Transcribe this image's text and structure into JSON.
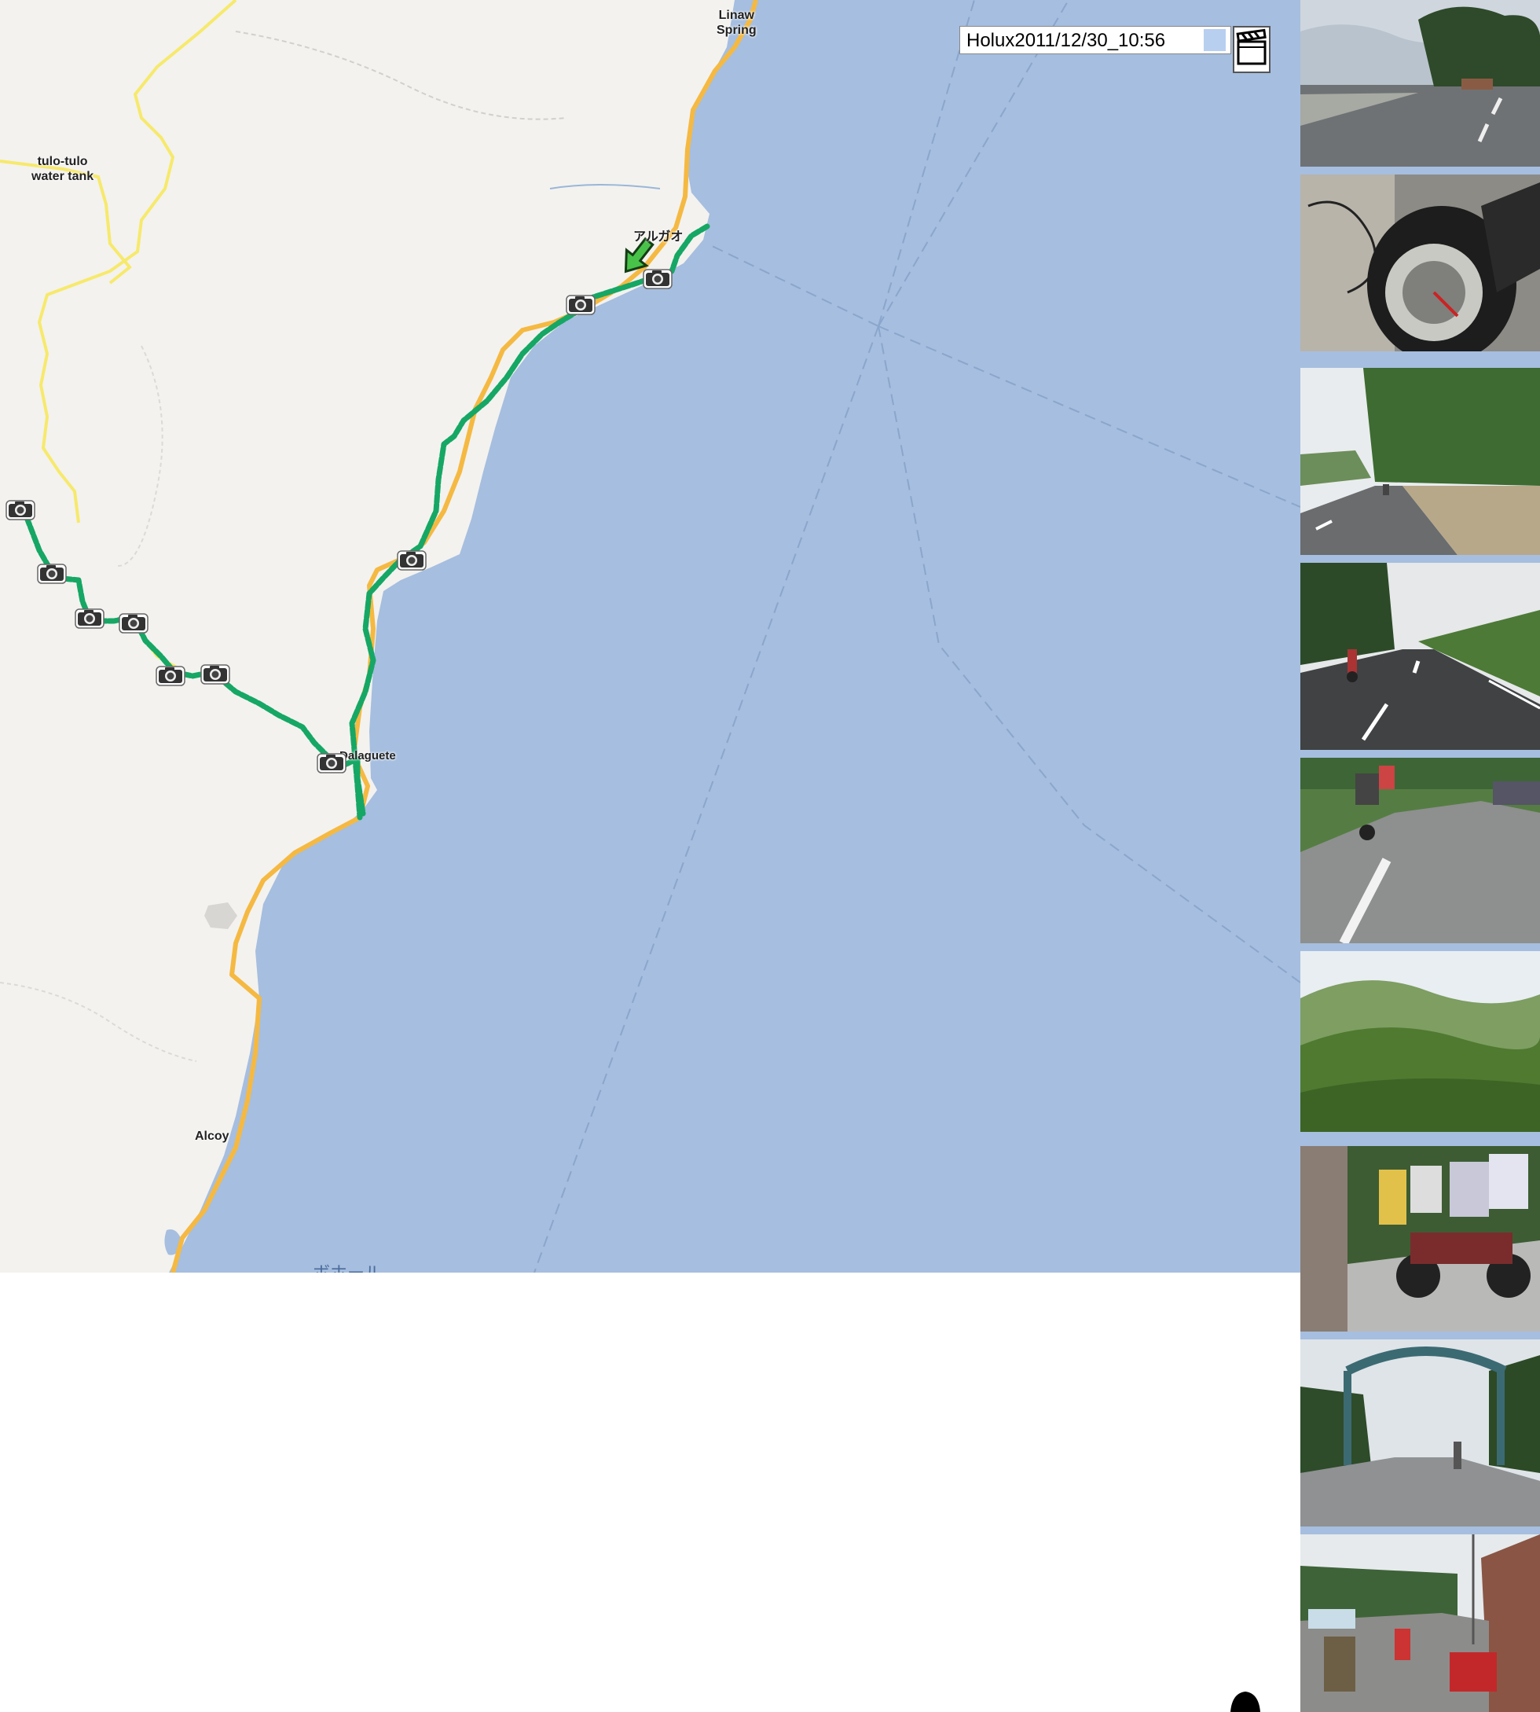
{
  "track": {
    "title": "Holux2011/12/30_10:56",
    "color": "#16a765"
  },
  "map": {
    "land_color": "#f3f2ef",
    "sea_color": "#a6bedf",
    "road_major_color": "#f5b942",
    "road_minor_color": "#f7e96b",
    "places": {
      "linaw": "Linaw\nSpring",
      "tulo": "tulo-tulo\nwater tank",
      "anda": "アルガオ",
      "dalaguete": "Dalaguete",
      "alcoy": "Alcoy"
    },
    "sea_label": "ボホール",
    "icons": {
      "camera": "camera-icon",
      "movie": "clapperboard-icon",
      "direction": "green-arrow-icon"
    }
  },
  "thumbnails": [
    {
      "name": "coastal-road"
    },
    {
      "name": "motorbike-dashboard"
    },
    {
      "name": "palm-road"
    },
    {
      "name": "rider-on-road"
    },
    {
      "name": "motorbikes-oncoming"
    },
    {
      "name": "green-hills"
    },
    {
      "name": "family-on-motorbike"
    },
    {
      "name": "town-arch"
    },
    {
      "name": "market-street"
    }
  ]
}
